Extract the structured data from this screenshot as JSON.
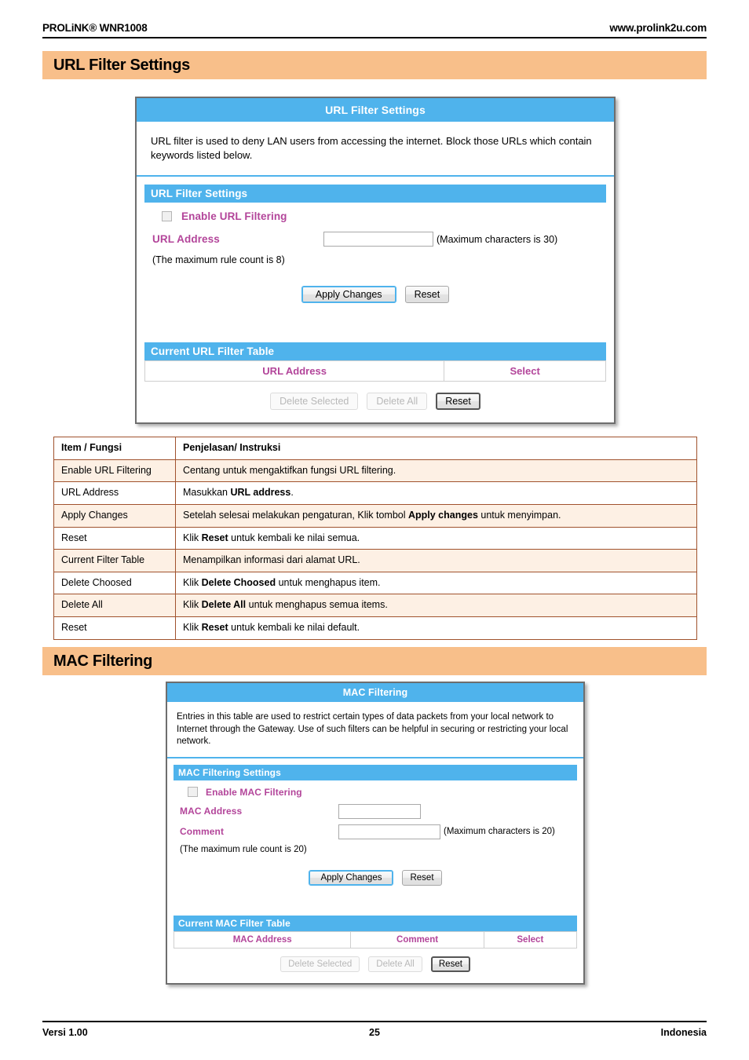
{
  "header": {
    "product": "PROLiNK® WNR1008",
    "website": "www.prolink2u.com"
  },
  "sections": [
    {
      "title": "URL Filter Settings"
    },
    {
      "title": "MAC Filtering"
    }
  ],
  "url_panel": {
    "window_title": "URL Filter Settings",
    "description": "URL filter is used to deny LAN users from accessing the internet. Block those URLs which contain keywords listed below.",
    "settings_bar": "URL Filter Settings",
    "enable_label": "Enable URL Filtering",
    "enable_checked": false,
    "url_address_label": "URL Address",
    "url_address_value": "",
    "url_address_hint": "(Maximum characters is 30)",
    "rule_count_note": "(The maximum rule count is 8)",
    "apply_label": "Apply Changes",
    "reset_label": "Reset",
    "table_bar": "Current URL Filter Table",
    "table_headers": [
      "URL Address",
      "Select"
    ],
    "table_rows": [],
    "delete_selected_label": "Delete Selected",
    "delete_all_label": "Delete All",
    "table_reset_label": "Reset"
  },
  "mac_panel": {
    "window_title": "MAC Filtering",
    "description": "Entries in this table are used to restrict certain types of data packets from your local network to Internet through the Gateway. Use of such filters can be helpful in securing or restricting your local network.",
    "settings_bar": "MAC Filtering Settings",
    "enable_label": "Enable MAC Filtering",
    "enable_checked": false,
    "mac_address_label": "MAC Address",
    "mac_address_value": "",
    "comment_label": "Comment",
    "comment_value": "",
    "comment_hint": "(Maximum characters is 20)",
    "rule_count_note": "(The maximum rule count is 20)",
    "apply_label": "Apply Changes",
    "reset_label": "Reset",
    "table_bar": "Current MAC Filter Table",
    "table_headers": [
      "MAC Address",
      "Comment",
      "Select"
    ],
    "table_rows": [],
    "delete_selected_label": "Delete Selected",
    "delete_all_label": "Delete All",
    "table_reset_label": "Reset"
  },
  "explanation_table": {
    "headers": [
      "Item / Fungsi",
      "Penjelasan/ Instruksi"
    ],
    "rows": [
      {
        "item": "Enable URL Filtering",
        "pre": "Centang untuk mengaktifkan fungsi URL filtering.",
        "strong": "",
        "post": ""
      },
      {
        "item": "URL Address",
        "pre": "Masukkan ",
        "strong": "URL address",
        "post": "."
      },
      {
        "item": "Apply Changes",
        "pre": "Setelah selesai melakukan pengaturan, Klik tombol ",
        "strong": "Apply changes",
        "post": " untuk menyimpan."
      },
      {
        "item": "Reset",
        "pre": "Klik ",
        "strong": "Reset",
        "post": " untuk kembali ke nilai semua."
      },
      {
        "item": "Current Filter Table",
        "pre": "Menampilkan informasi dari alamat URL.",
        "strong": "",
        "post": ""
      },
      {
        "item": "Delete Choosed",
        "pre": "Klik ",
        "strong": "Delete Choosed",
        "post": " untuk menghapus item."
      },
      {
        "item": "Delete All",
        "pre": "Klik ",
        "strong": "Delete All",
        "post": " untuk menghapus semua items."
      },
      {
        "item": "Reset",
        "pre": "Klik ",
        "strong": "Reset",
        "post": " untuk kembali ke nilai default."
      }
    ]
  },
  "footer": {
    "version": "Versi 1.00",
    "page_number": "25",
    "language": "Indonesia"
  },
  "colors": {
    "banner_orange": "#f8bf8a",
    "ui_blue": "#4fb3ec",
    "label_magenta": "#b3459a",
    "table_border_brown": "#a0522d",
    "table_alt_row": "#fdf0e4"
  }
}
